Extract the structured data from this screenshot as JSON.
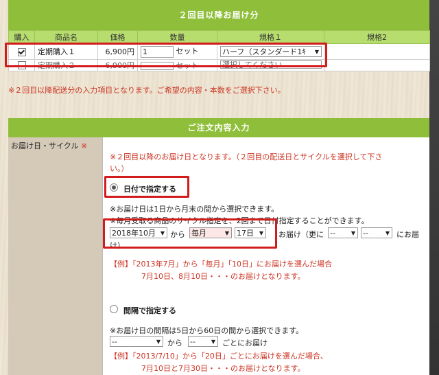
{
  "subsequent": {
    "header": "２回目以降お届け分",
    "columns": [
      "購入",
      "商品名",
      "価格",
      "数量",
      "規格１",
      "規格2"
    ],
    "rows": [
      {
        "checked": true,
        "name": "定期購入１",
        "price": "6,900円",
        "qty": "1",
        "unit": "セット",
        "spec1": "ハーフ（スタンダード1ｷ"
      },
      {
        "checked": false,
        "name": "定期購入２",
        "price": "6,900円",
        "qty": "",
        "unit": "セット",
        "spec1": "選択してください"
      }
    ],
    "note": "※２回目以降配送分の入力項目となります。ご希望の内容・本数をご選択下さい。"
  },
  "order": {
    "header": "ご注文内容入力",
    "left_label": "お届け日・サイクル",
    "required_mark": "※",
    "intro_line1": "※２回目以降のお届け日となります。（２回目の配送日とサイクルを選択して下さ",
    "intro_line2": "い。）",
    "date_option": {
      "label": "日付で指定する",
      "note1": "※お届け日は1日から月末の間から選択できます。",
      "note2": "※毎月受取る商品のサイクル指定を、2回まで日付指定することができます。",
      "month": "2018年10月",
      "from": "から",
      "cycle": "毎月",
      "day": "17日",
      "deliver": "お届け（更に",
      "extra1": "--",
      "extra2": "--",
      "deliver_end": "にお届",
      "deliver_end2": "け）",
      "example1": "【例】「2013年7月」から「毎月」「10日」にお届けを選んだ場合",
      "example2": "7月10日、8月10日・・・のお届けとなります。"
    },
    "interval_option": {
      "label": "間隔で指定する",
      "note": "※お届け日の間隔は5日から60日の間から選択できます。",
      "sel1": "--",
      "from": "から",
      "sel2": "--",
      "after": "ごとにお届け",
      "example1": "【例】「2013/7/10」から「20日」ごとにお届けを選んだ場合、",
      "example2": "7月10日と7月30日・・・のお届けとなります。"
    }
  },
  "colors": {
    "green_header": "#8fbf3a",
    "green_sub": "#b7dd6e",
    "highlight": "#d21b1b",
    "note_red": "#cc3322"
  }
}
